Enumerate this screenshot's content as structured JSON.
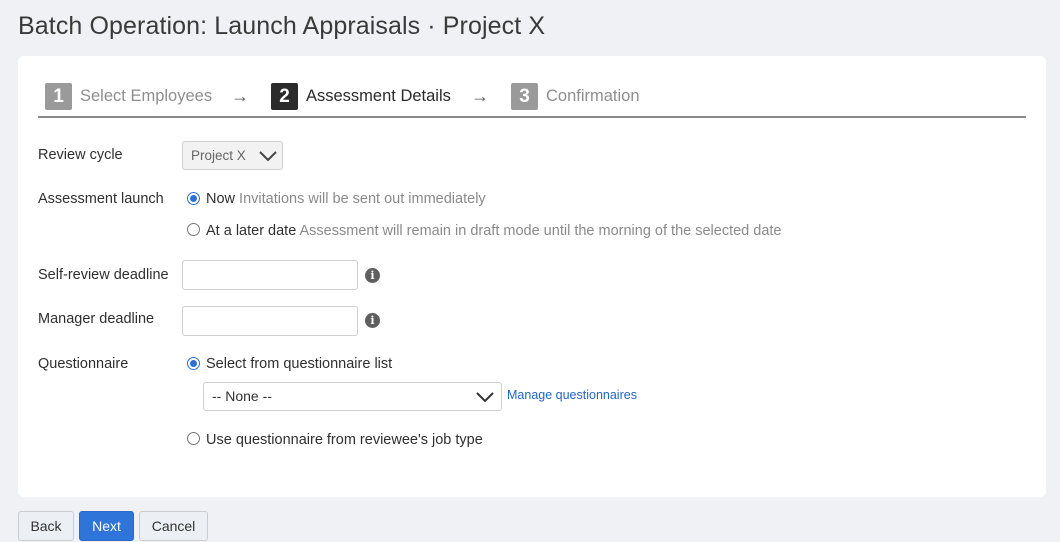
{
  "page": {
    "title": "Batch Operation: Launch Appraisals · Project X"
  },
  "steps": [
    {
      "number": "1",
      "label": "Select Employees",
      "state": "inactive"
    },
    {
      "number": "2",
      "label": "Assessment Details",
      "state": "active"
    },
    {
      "number": "3",
      "label": "Confirmation",
      "state": "inactive"
    }
  ],
  "step_arrow": "→",
  "form": {
    "review_cycle": {
      "label": "Review cycle",
      "value": "Project X"
    },
    "assessment_launch": {
      "label": "Assessment launch",
      "options": [
        {
          "label": "Now",
          "hint": "Invitations will be sent out immediately",
          "checked": true
        },
        {
          "label": "At a later date",
          "hint": "Assessment will remain in draft mode until the morning of the selected date",
          "checked": false
        }
      ]
    },
    "self_review_deadline": {
      "label": "Self-review deadline",
      "value": ""
    },
    "manager_deadline": {
      "label": "Manager deadline",
      "value": ""
    },
    "info_glyph": "i",
    "questionnaire": {
      "label": "Questionnaire",
      "option_list": {
        "label": "Select from questionnaire list",
        "checked": true
      },
      "select_value": "-- None --",
      "manage_link": "Manage questionnaires",
      "option_job_type": {
        "label": "Use questionnaire from reviewee's job type",
        "checked": false
      }
    }
  },
  "buttons": {
    "back": "Back",
    "next": "Next",
    "cancel": "Cancel"
  },
  "colors": {
    "primary": "#2f74d8",
    "link": "#1f66c2",
    "background": "#f0f1f4"
  }
}
